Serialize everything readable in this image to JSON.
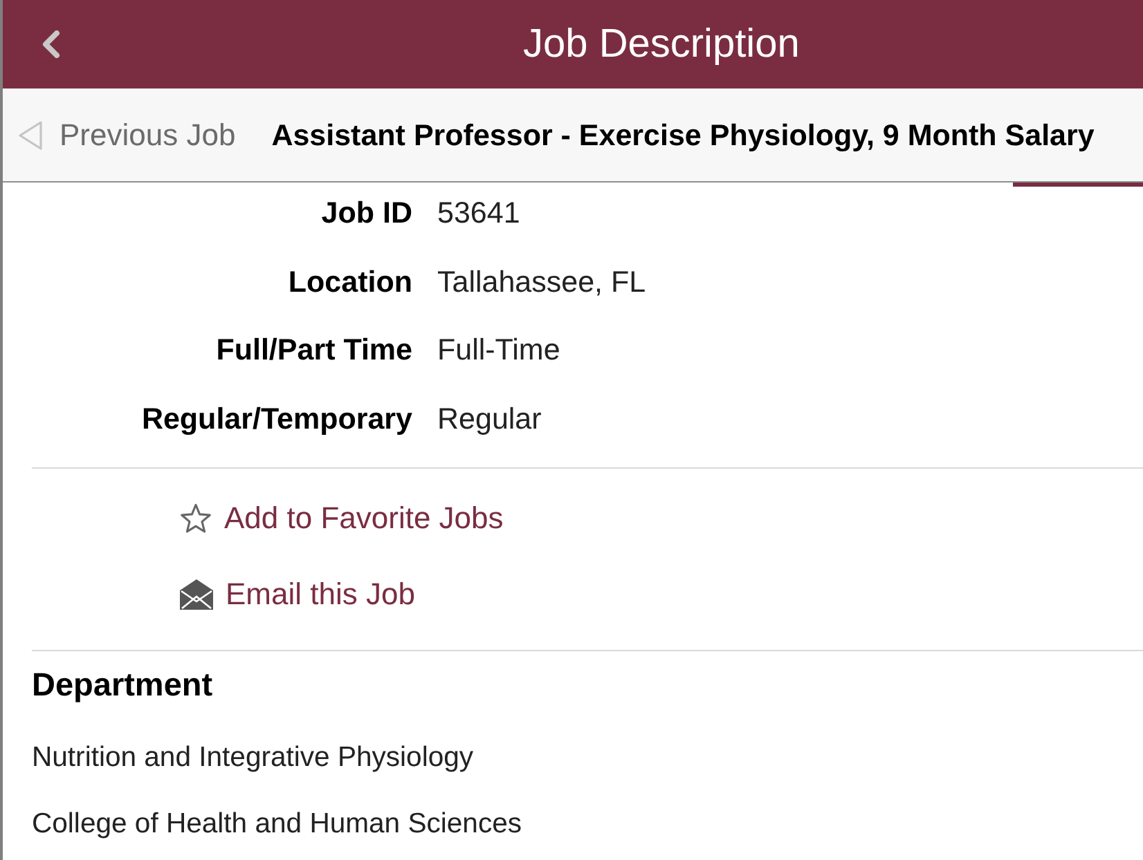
{
  "header": {
    "title": "Job Description"
  },
  "job_nav": {
    "previous_label": "Previous Job",
    "job_title": "Assistant Professor - Exercise Physiology, 9 Month Salary"
  },
  "details": [
    {
      "label": "Job ID",
      "value": "53641"
    },
    {
      "label": "Location",
      "value": "Tallahassee, FL"
    },
    {
      "label": "Full/Part Time",
      "value": "Full-Time"
    },
    {
      "label": "Regular/Temporary",
      "value": "Regular"
    }
  ],
  "actions": [
    {
      "kind": "favorite",
      "label": "Add to Favorite Jobs"
    },
    {
      "kind": "email",
      "label": "Email this Job"
    }
  ],
  "department": {
    "heading": "Department",
    "lines": [
      "Nutrition and Integrative Physiology",
      "College of Health and Human Sciences"
    ]
  }
}
